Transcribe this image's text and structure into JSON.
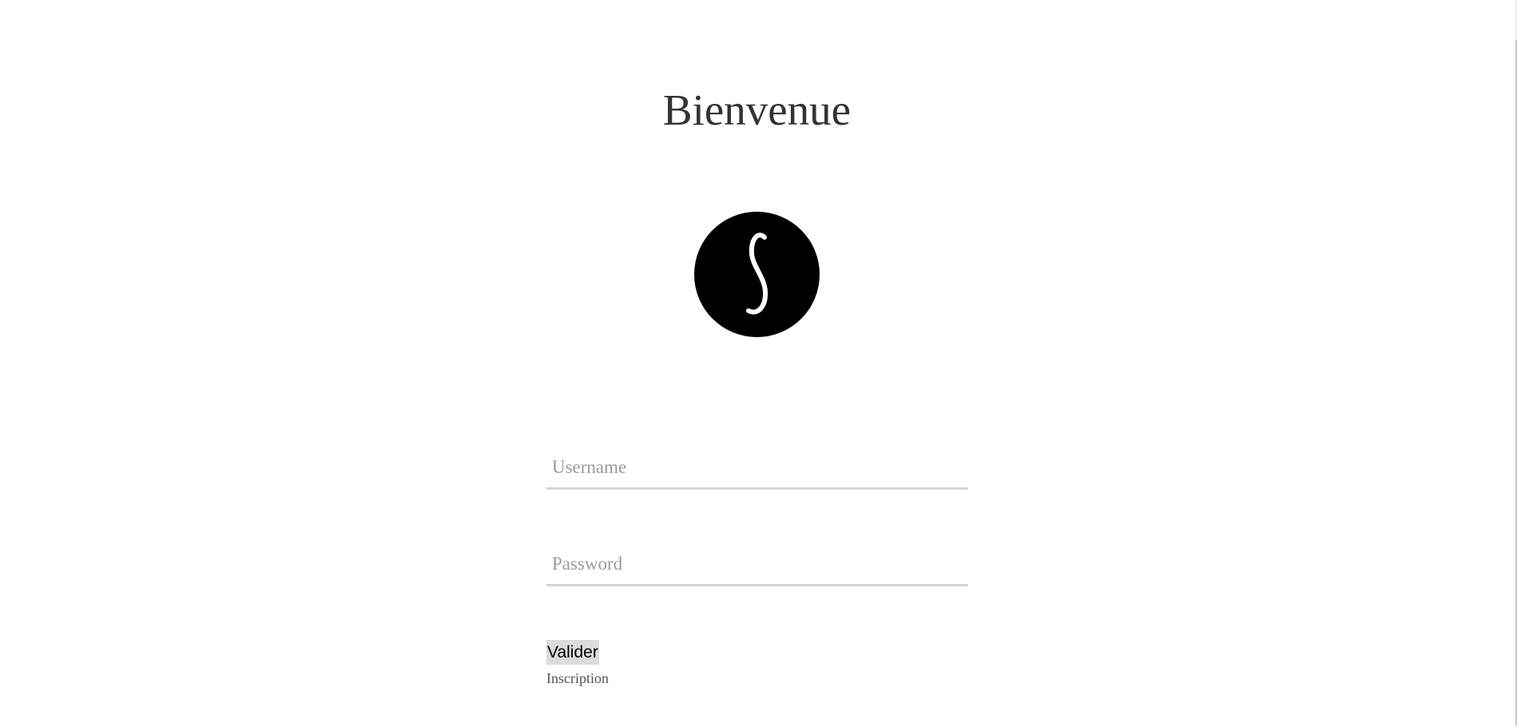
{
  "page": {
    "title": "Bienvenue"
  },
  "logo": {
    "icon": "s-integral-logo-icon",
    "background": "#000000",
    "glyph_color": "#ffffff"
  },
  "form": {
    "username": {
      "value": "",
      "placeholder": "Username"
    },
    "password": {
      "value": "",
      "placeholder": "Password"
    },
    "submit_label": "Valider",
    "signup_link": "Inscription"
  },
  "colors": {
    "title": "#333333",
    "field_underline": "#d6d6d6",
    "placeholder": "#9a9a9a",
    "button_bg": "#dcdcdc"
  }
}
